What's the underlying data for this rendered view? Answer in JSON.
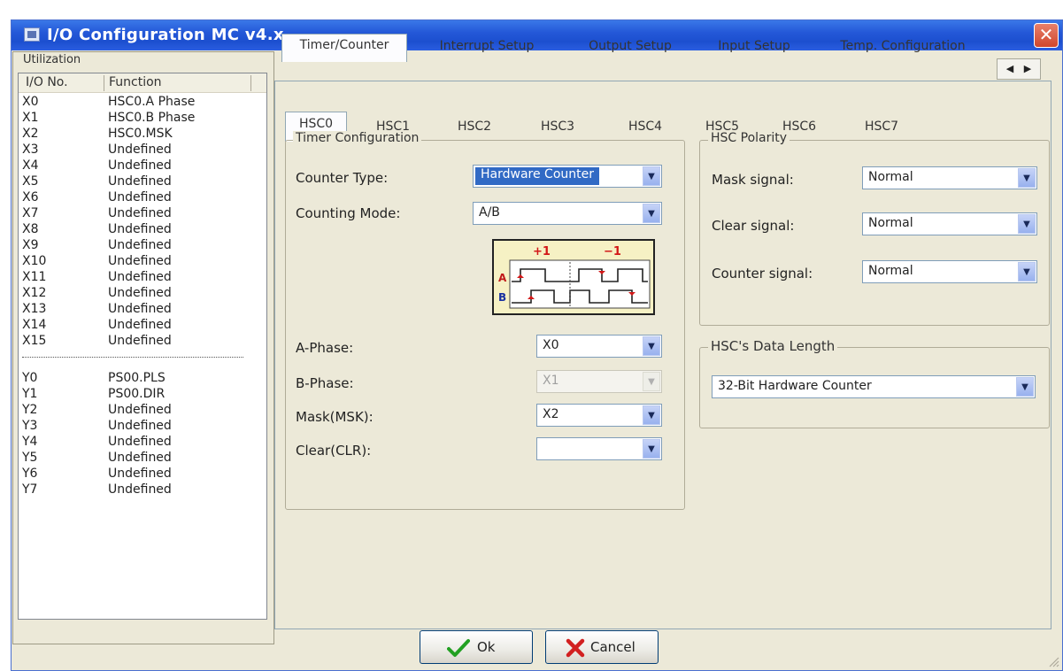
{
  "window": {
    "title": "I/O Configuration MC v4.x",
    "close_icon": "close-icon"
  },
  "utilization": {
    "legend": "Utilization",
    "columns": [
      "I/O No.",
      "Function"
    ],
    "inputs": [
      {
        "io": "X0",
        "fn": "HSC0.A Phase"
      },
      {
        "io": "X1",
        "fn": "HSC0.B Phase"
      },
      {
        "io": "X2",
        "fn": "HSC0.MSK"
      },
      {
        "io": "X3",
        "fn": "Undefined"
      },
      {
        "io": "X4",
        "fn": "Undefined"
      },
      {
        "io": "X5",
        "fn": "Undefined"
      },
      {
        "io": "X6",
        "fn": "Undefined"
      },
      {
        "io": "X7",
        "fn": "Undefined"
      },
      {
        "io": "X8",
        "fn": "Undefined"
      },
      {
        "io": "X9",
        "fn": "Undefined"
      },
      {
        "io": "X10",
        "fn": "Undefined"
      },
      {
        "io": "X11",
        "fn": "Undefined"
      },
      {
        "io": "X12",
        "fn": "Undefined"
      },
      {
        "io": "X13",
        "fn": "Undefined"
      },
      {
        "io": "X14",
        "fn": "Undefined"
      },
      {
        "io": "X15",
        "fn": "Undefined"
      }
    ],
    "outputs": [
      {
        "io": "Y0",
        "fn": "PS00.PLS"
      },
      {
        "io": "Y1",
        "fn": "PS00.DIR"
      },
      {
        "io": "Y2",
        "fn": "Undefined"
      },
      {
        "io": "Y3",
        "fn": "Undefined"
      },
      {
        "io": "Y4",
        "fn": "Undefined"
      },
      {
        "io": "Y5",
        "fn": "Undefined"
      },
      {
        "io": "Y6",
        "fn": "Undefined"
      },
      {
        "io": "Y7",
        "fn": "Undefined"
      }
    ]
  },
  "tabs": [
    "Timer/Counter",
    "Interrupt Setup",
    "Output Setup",
    "Input Setup",
    "Temp. Configuration"
  ],
  "tab_scroll": {
    "left": "◀",
    "right": "▶"
  },
  "subtabs": [
    "HSC0",
    "HSC1",
    "HSC2",
    "HSC3",
    "HSC4",
    "HSC5",
    "HSC6",
    "HSC7"
  ],
  "timer_config": {
    "title": "Timer Configuration",
    "counter_type_label": "Counter Type:",
    "counter_type_value": "Hardware Counter",
    "counting_mode_label": "Counting Mode:",
    "counting_mode_value": "A/B",
    "diagram": {
      "plus": "+1",
      "minus": "−1",
      "a": "A",
      "b": "B"
    },
    "a_phase_label": "A-Phase:",
    "a_phase_value": "X0",
    "b_phase_label": "B-Phase:",
    "b_phase_value": "X1",
    "mask_label": "Mask(MSK):",
    "mask_value": "X2",
    "clear_label": "Clear(CLR):",
    "clear_value": ""
  },
  "hsc_polarity": {
    "title": "HSC Polarity",
    "mask_label": "Mask signal:",
    "mask_value": "Normal",
    "clear_label": "Clear signal:",
    "clear_value": "Normal",
    "counter_label": "Counter signal:",
    "counter_value": "Normal"
  },
  "data_length": {
    "title": "HSC's Data Length",
    "value": "32-Bit Hardware Counter"
  },
  "buttons": {
    "ok": "Ok",
    "cancel": "Cancel"
  },
  "colors": {
    "title_bar": "#2458d8",
    "selection": "#316ac5",
    "ok_check": "#22a022",
    "cancel_x": "#d22020",
    "diagram_bg": "#f6f1c4"
  }
}
